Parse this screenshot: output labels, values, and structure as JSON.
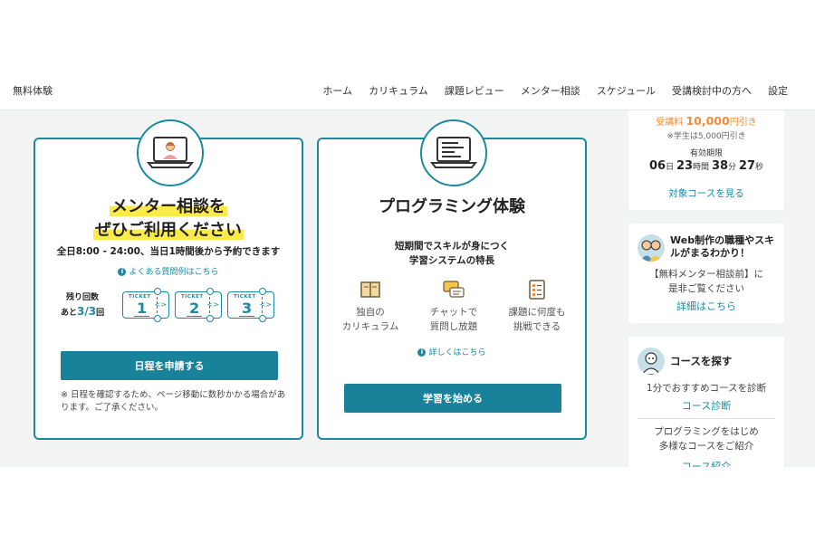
{
  "nav": {
    "brand": "無料体験",
    "links": [
      "ホーム",
      "カリキュラム",
      "課題レビュー",
      "メンター相談",
      "スケジュール",
      "受講検討中の方へ",
      "設定"
    ]
  },
  "mentor_card": {
    "title_line1": "メンター相談を",
    "title_line2": "ぜひご利用ください",
    "hours": "全日8:00 - 24:00、当日1時間後から予約できます",
    "faq_link": "よくある質問例はこちら",
    "remaining_label": "残り回数",
    "remaining_prefix": "あと",
    "remaining_count": "3/3",
    "remaining_suffix": "回",
    "ticket_label": "TICKET",
    "tickets": [
      "1",
      "2",
      "3"
    ],
    "button": "日程を申請する",
    "note": "※ 日程を確認するため、ページ移動に数秒かかる場合があります。ご了承ください。"
  },
  "programming_card": {
    "title": "プログラミング体験",
    "subtitle_line1": "短期間でスキルが身につく",
    "subtitle_line2": "学習システムの特長",
    "features": [
      {
        "line1": "独自の",
        "line2": "カリキュラム",
        "icon": "book-icon"
      },
      {
        "line1": "チャットで",
        "line2": "質問し放題",
        "icon": "chat-icon"
      },
      {
        "line1": "課題に何度も",
        "line2": "挑戦できる",
        "icon": "checklist-icon"
      }
    ],
    "more_link": "詳しくはこちら",
    "button": "学習を始める"
  },
  "sidebar": {
    "discount_prefix": "受講料 ",
    "discount_amount": "10,000",
    "discount_suffix": "円引き",
    "student_note": "※学生は5,000円引き",
    "expiry_label": "有効期限",
    "countdown": {
      "days": "06",
      "days_unit": "日",
      "hours": "23",
      "hours_unit": "時間",
      "minutes": "38",
      "minutes_unit": "分",
      "seconds": "27",
      "seconds_unit": "秒"
    },
    "target_link": "対象コースを見る",
    "card2_head_line1": "Web制作の職種やスキ",
    "card2_head_line2": "ルがまるわかり！",
    "card2_text_line1": "【無料メンター相談前】に",
    "card2_text_line2": "是非ご覧ください",
    "card2_link": "詳細はこちら",
    "card3_head": "コースを探す",
    "card3_text1": "1分でおすすめコースを診断",
    "card3_link1": "コース診断",
    "card3_text2_line1": "プログラミングをはじめ",
    "card3_text2_line2": "多様なコースをご紹介",
    "card3_link2": "コース紹介"
  },
  "colors": {
    "accent": "#17829a",
    "highlight": "#fbea4a",
    "discount": "#f08c3c"
  }
}
